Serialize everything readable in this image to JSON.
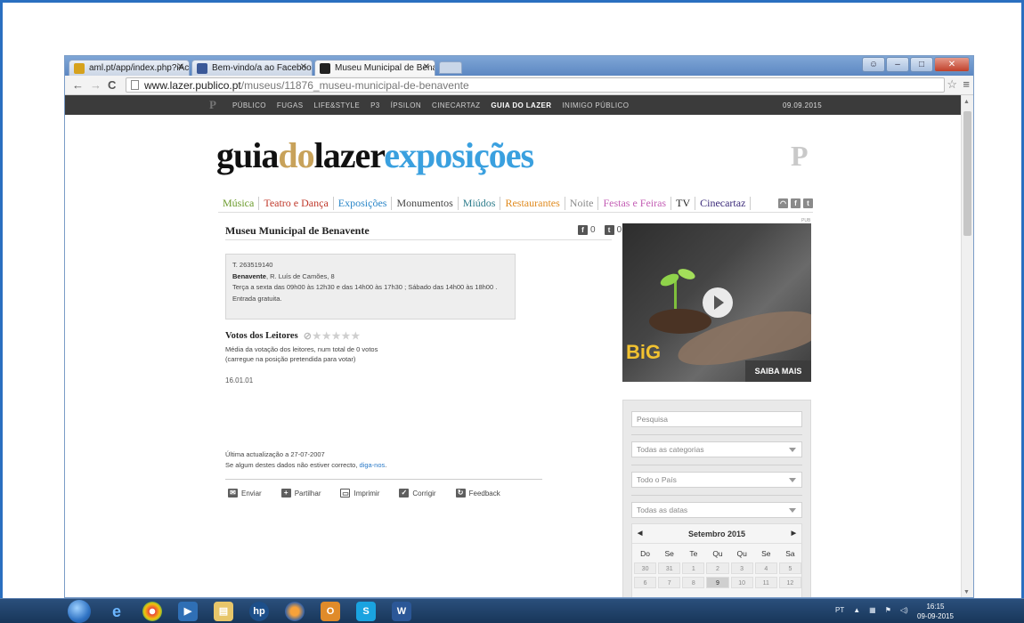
{
  "browser": {
    "tabs": [
      {
        "title": "aml.pt/app/index.php?iAc",
        "favicon": "aml-favicon",
        "active": false
      },
      {
        "title": "Bem-vindo/a ao Faceboo",
        "favicon": "facebook-favicon",
        "active": false
      },
      {
        "title": "Museu Municipal de Bena",
        "favicon": "publico-favicon",
        "active": true
      }
    ],
    "url_host": "www.lazer.publico.pt",
    "url_path": "/museus/11876_museu-municipal-de-benavente"
  },
  "site_nav": {
    "logo": "P",
    "links": [
      "PÚBLICO",
      "FUGAS",
      "LIFE&STYLE",
      "P3",
      "ÍPSILON",
      "CINECARTAZ",
      "GUIA DO LAZER",
      "INIMIGO PÚBLICO"
    ],
    "highlight": "GUIA DO LAZER",
    "date": "09.09.2015"
  },
  "header": {
    "logo_part1": "guia",
    "logo_part2": "do",
    "logo_part3": "lazer",
    "logo_part4": "exposições",
    "p_mark": "P"
  },
  "categories": [
    {
      "label": "Música",
      "color": "#6a9a2a"
    },
    {
      "label": "Teatro e Dança",
      "color": "#c0392b"
    },
    {
      "label": "Exposições",
      "color": "#2a86c8"
    },
    {
      "label": "Monumentos",
      "color": "#444444"
    },
    {
      "label": "Miúdos",
      "color": "#2e7d8c"
    },
    {
      "label": "Restaurantes",
      "color": "#e08a1e"
    },
    {
      "label": "Noite",
      "color": "#8a8a8a"
    },
    {
      "label": "Festas e Feiras",
      "color": "#c45fb5"
    },
    {
      "label": "TV",
      "color": "#222222"
    },
    {
      "label": "Cinecartaz",
      "color": "#3b2a7a"
    }
  ],
  "museum": {
    "title": "Museu Municipal de Benavente",
    "fb_count": "0",
    "tw_count": "0",
    "phone": "T. 263519140",
    "city": "Benavente",
    "address": ", R. Luís de Camões, 8",
    "hours": "Terça a sexta das 09h00 às 12h30 e das 14h00 às 17h30 ; Sábado das 14h00 às 18h00 .",
    "entry": "Entrada gratuita."
  },
  "votes": {
    "title": "Votos dos Leitores",
    "line1": "Média da votação dos leitores, num total de 0 votos",
    "line2": "(carregue na posição pretendida para votar)",
    "rating": 0
  },
  "code": "16.01.01",
  "update": {
    "line1": "Última actualização a 27-07-2007",
    "line2_prefix": "Se algum destes dados não estiver correcto, ",
    "line2_link": "diga-nos",
    "line2_suffix": "."
  },
  "actions": [
    {
      "label": "Enviar",
      "icon": "envelope-icon"
    },
    {
      "label": "Partilhar",
      "icon": "plus-icon"
    },
    {
      "label": "Imprimir",
      "icon": "printer-icon"
    },
    {
      "label": "Corrigir",
      "icon": "check-icon"
    },
    {
      "label": "Feedback",
      "icon": "feedback-icon"
    }
  ],
  "ad": {
    "pub_label": "PUB",
    "brand": "BiG",
    "cta": "SAIBA MAIS"
  },
  "sidebar": {
    "search_placeholder": "Pesquisa",
    "category_select": "Todas as categorias",
    "region_select": "Todo o País",
    "date_select": "Todas as datas"
  },
  "calendar": {
    "month": "Setembro 2015",
    "weekdays": [
      "Do",
      "Se",
      "Te",
      "Qu",
      "Qu",
      "Se",
      "Sa"
    ],
    "days": [
      "30",
      "31",
      "1",
      "2",
      "3",
      "4",
      "5",
      "6",
      "7",
      "8",
      "9",
      "10",
      "11",
      "12"
    ],
    "today": "9"
  },
  "taskbar": {
    "lang": "PT",
    "time": "16:15",
    "date": "09-09-2015"
  }
}
